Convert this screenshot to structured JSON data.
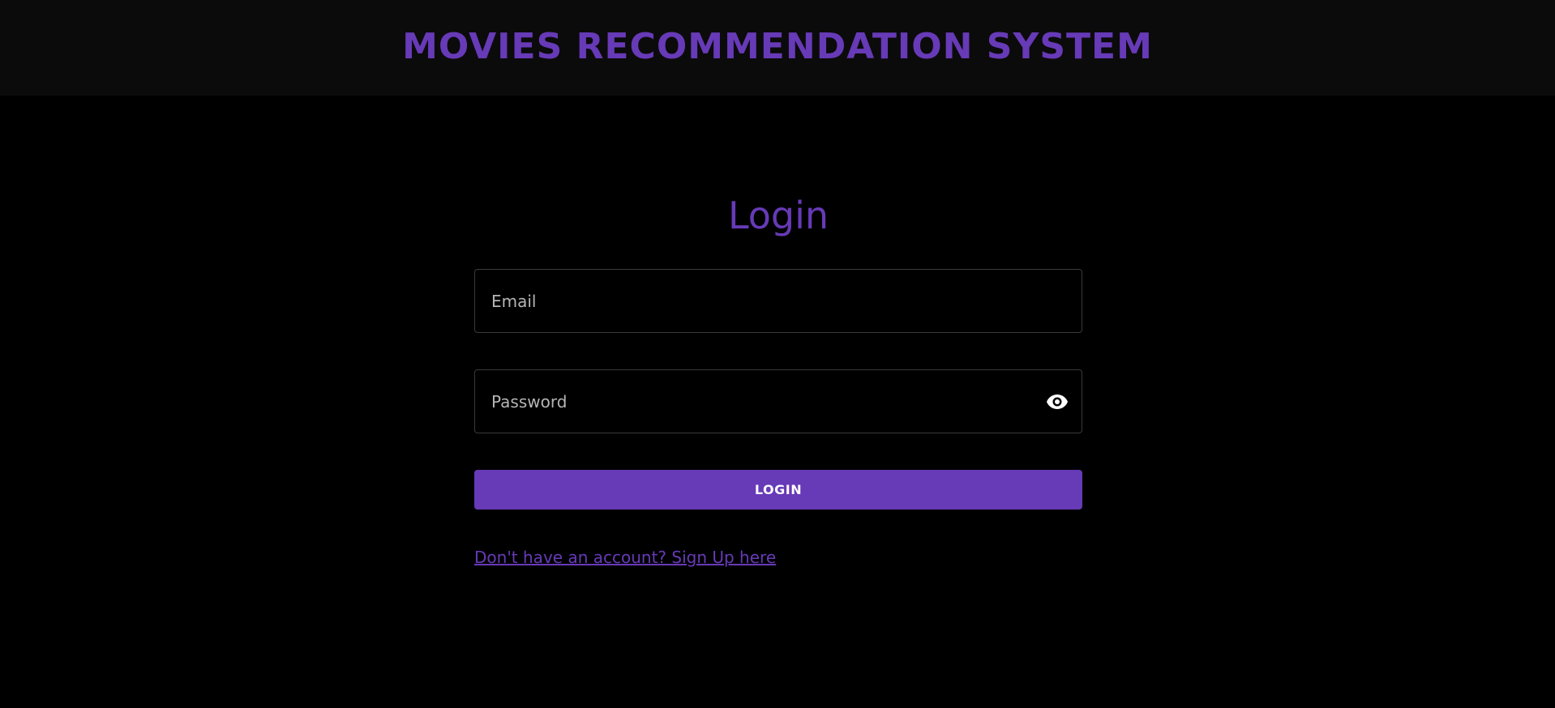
{
  "header": {
    "title": "MOVIES RECOMMENDATION SYSTEM"
  },
  "login": {
    "title": "Login",
    "email_placeholder": "Email",
    "password_placeholder": "Password",
    "button_label": "LOGIN",
    "signup_link": "Don't have an account? Sign Up here",
    "password_toggle_icon": "eye-icon"
  },
  "colors": {
    "accent": "#673ab7",
    "background": "#000000",
    "header_background": "#0b0b0b",
    "field_border": "#3a3a3a"
  }
}
